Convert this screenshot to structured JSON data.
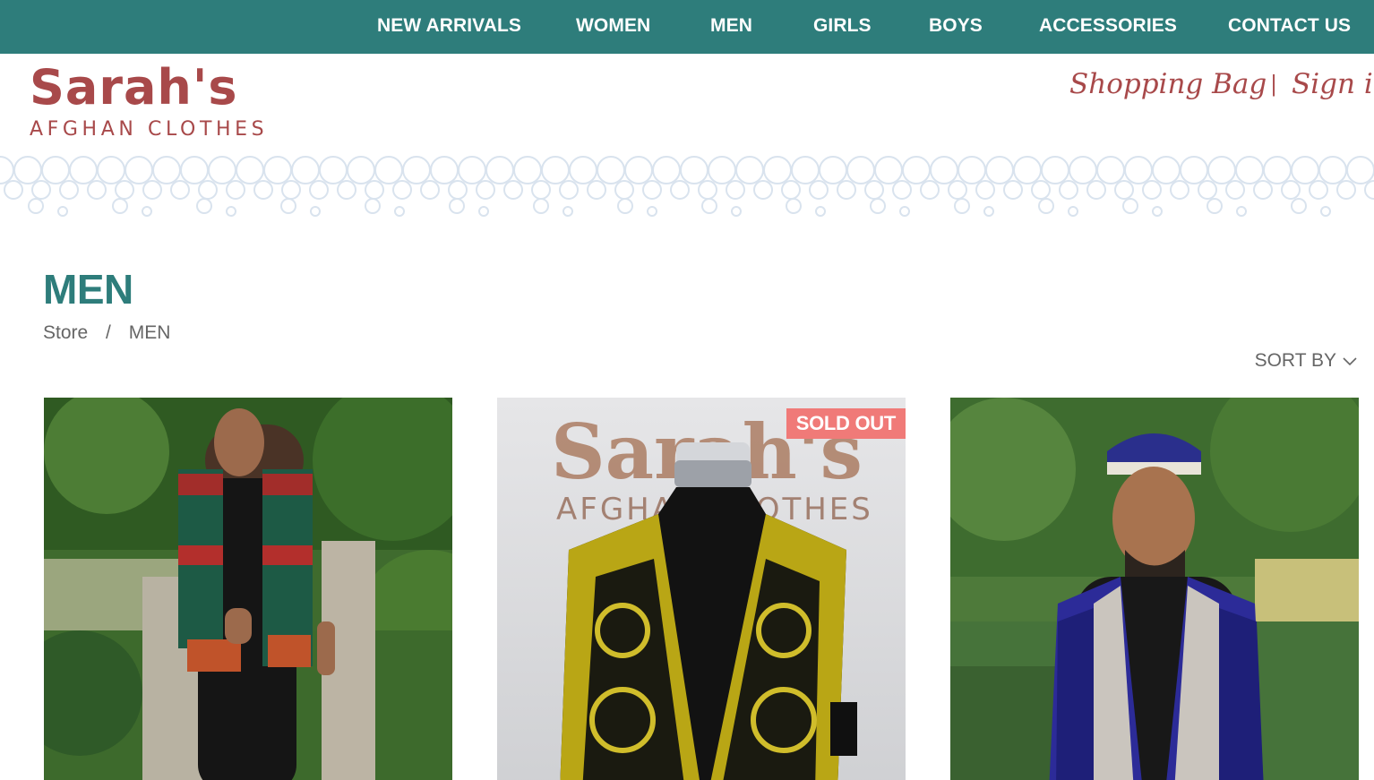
{
  "nav": {
    "items": [
      {
        "label": "NEW ARRIVALS"
      },
      {
        "label": "WOMEN"
      },
      {
        "label": "MEN"
      },
      {
        "label": "GIRLS"
      },
      {
        "label": "BOYS"
      },
      {
        "label": "ACCESSORIES"
      },
      {
        "label": "CONTACT US"
      }
    ]
  },
  "logo": {
    "name": "Sarah's",
    "tagline": "AFGHAN CLOTHES"
  },
  "user_links": {
    "bag": "Shopping Bag",
    "separator": "|",
    "sign_in": "Sign in"
  },
  "page": {
    "title": "MEN",
    "breadcrumb": {
      "home": "Store",
      "separator": "/",
      "current": "MEN"
    },
    "sort_label": "SORT BY"
  },
  "products": [
    {
      "badge": ""
    },
    {
      "badge": "SOLD OUT"
    },
    {
      "badge": ""
    }
  ],
  "colors": {
    "nav_bg": "#2e7d7b",
    "brand": "#a8494a",
    "title": "#2e7d7b",
    "badge": "#f07a78"
  }
}
